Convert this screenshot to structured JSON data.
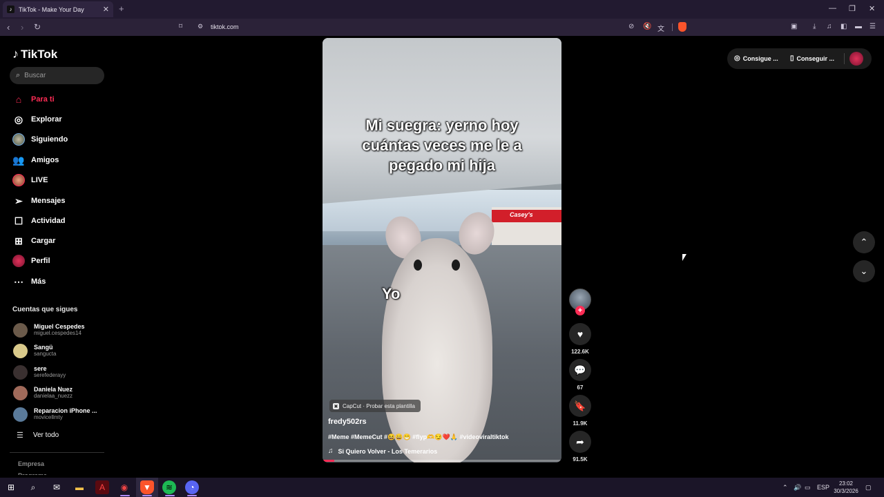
{
  "browser": {
    "tab_title": "TikTok - Make Your Day",
    "tab_close": "✕",
    "new_tab": "+",
    "url": "tiktok.com",
    "window_controls": [
      "—",
      "❐",
      "✕"
    ]
  },
  "sidebar": {
    "logo": "TikTok",
    "search_placeholder": "Buscar",
    "nav": [
      {
        "label": "Para ti",
        "icon": "home-icon",
        "active": true
      },
      {
        "label": "Explorar",
        "icon": "compass-icon"
      },
      {
        "label": "Siguiendo",
        "icon": "following-avatar-icon"
      },
      {
        "label": "Amigos",
        "icon": "friends-icon"
      },
      {
        "label": "LIVE",
        "icon": "live-icon"
      },
      {
        "label": "Mensajes",
        "icon": "messages-icon"
      },
      {
        "label": "Actividad",
        "icon": "activity-icon"
      },
      {
        "label": "Cargar",
        "icon": "upload-icon"
      },
      {
        "label": "Perfil",
        "icon": "profile-icon"
      },
      {
        "label": "Más",
        "icon": "more-icon"
      }
    ],
    "following_title": "Cuentas que sigues",
    "accounts": [
      {
        "name": "Miguel Cespedes",
        "handle": "miguel.cespedes14",
        "color": "#6b5a4a"
      },
      {
        "name": "Sangü",
        "handle": "sangucta",
        "color": "#d9c98a"
      },
      {
        "name": "sere",
        "handle": "serefederayy",
        "color": "#3a3030"
      },
      {
        "name": "Daniela Nuez",
        "handle": "danielaa_nuezz",
        "color": "#a06a5a"
      },
      {
        "name": "Reparacion iPhone ...",
        "handle": "movicellmty",
        "color": "#5a7a9a"
      }
    ],
    "see_all": "Ver todo",
    "footer": [
      "Empresa",
      "Programa"
    ]
  },
  "video": {
    "caption": "Mi suegra: yerno hoy cuántas veces me le a pegado mi hija",
    "overlay_text": "Yo",
    "store_sign": "Casey's",
    "capcut": "CapCut · Probar esta plantilla",
    "author": "fredy502rs",
    "description": "#Meme #MemeCut #😆😄😁 #flyp🫶😏❤️🙏 #videoviraltiktok",
    "music": "Si Quiero Volver - Los Temerarios",
    "progress": 0.05
  },
  "actions": {
    "likes": "122.6K",
    "comments": "67",
    "saves": "11.9K",
    "shares": "91.5K"
  },
  "topbar": {
    "get_coins": "Consigue ...",
    "get_app": "Conseguir ..."
  },
  "taskbar": {
    "lang": "ESP",
    "time": "23:02",
    "date": "30/3/2026"
  },
  "colors": {
    "accent": "#fe2c55",
    "browser_chrome": "#221a30"
  }
}
